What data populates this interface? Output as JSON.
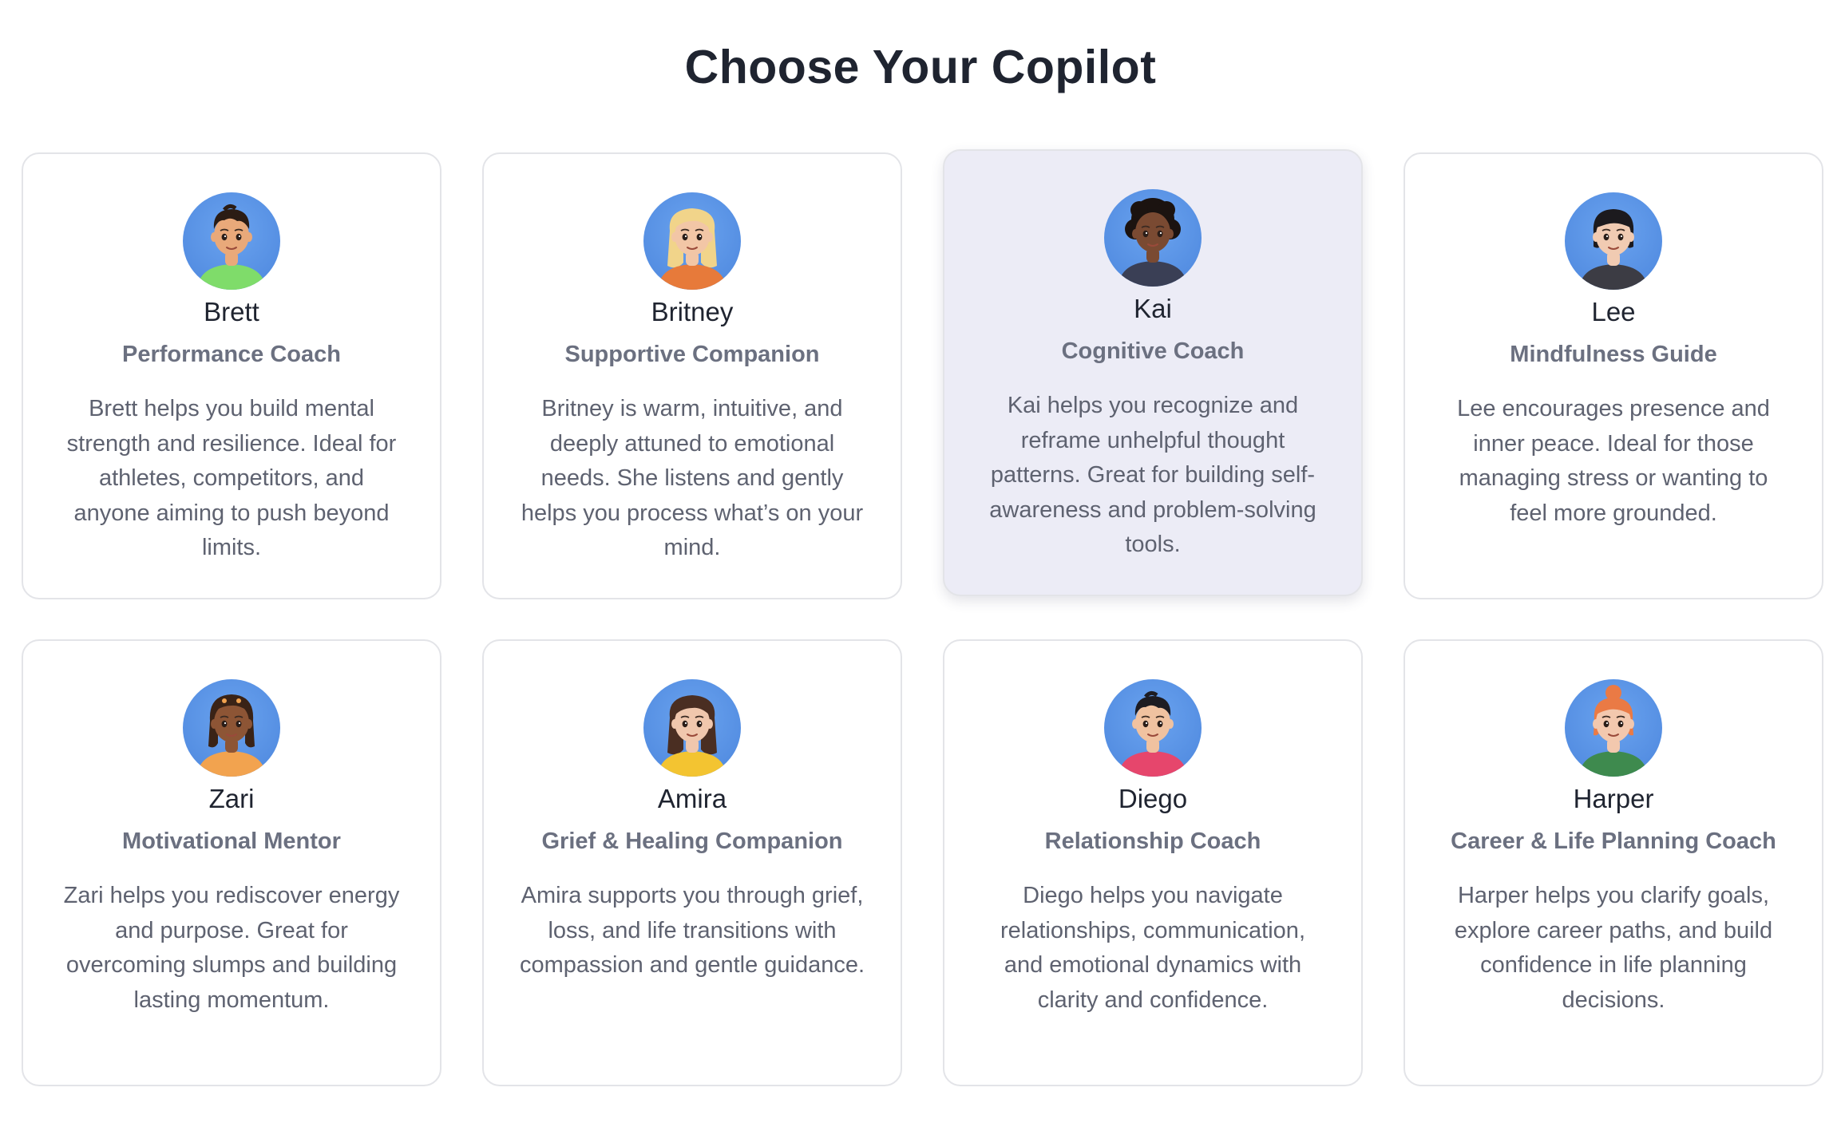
{
  "page": {
    "title": "Choose Your Copilot"
  },
  "selected": "kai",
  "copilots": [
    {
      "id": "brett",
      "name": "Brett",
      "role": "Performance Coach",
      "description": "Brett helps you build mental strength and resilience. Ideal for athletes, competitors, and anyone aiming to push beyond limits.",
      "avatar": {
        "skin": "#e9a97a",
        "hair": "#2b1c14",
        "shirt": "#7fdc6a",
        "hair_style": "short"
      }
    },
    {
      "id": "britney",
      "name": "Britney",
      "role": "Supportive Companion",
      "description": "Britney is warm, intuitive, and deeply attuned to emotional needs. She listens and gently helps you process what’s on your mind.",
      "avatar": {
        "skin": "#f2c6a6",
        "hair": "#f1d48a",
        "shirt": "#e77a3a",
        "hair_style": "long"
      }
    },
    {
      "id": "kai",
      "name": "Kai",
      "role": "Cognitive Coach",
      "description": "Kai helps you recognize and reframe unhelpful thought patterns. Great for building self-awareness and problem-solving tools.",
      "avatar": {
        "skin": "#7a4a32",
        "hair": "#1b1310",
        "shirt": "#3a3f55",
        "hair_style": "curly"
      }
    },
    {
      "id": "lee",
      "name": "Lee",
      "role": "Mindfulness Guide",
      "description": "Lee encourages presence and inner peace. Ideal for those managing stress or wanting to feel more grounded.",
      "avatar": {
        "skin": "#f1cbb2",
        "hair": "#1c1a1e",
        "shirt": "#3c3c44",
        "hair_style": "bob"
      }
    },
    {
      "id": "zari",
      "name": "Zari",
      "role": "Motivational Mentor",
      "description": "Zari helps you rediscover energy and purpose. Great for overcoming slumps and building lasting momentum.",
      "avatar": {
        "skin": "#8d5535",
        "hair": "#3a2316",
        "shirt": "#f2a34f",
        "hair_style": "locs"
      }
    },
    {
      "id": "amira",
      "name": "Amira",
      "role": "Grief & Healing Companion",
      "description": "Amira supports you through grief, loss, and life transitions with compassion and gentle guidance.",
      "avatar": {
        "skin": "#f0c7ad",
        "hair": "#4a2e22",
        "shirt": "#f3c431",
        "hair_style": "long"
      }
    },
    {
      "id": "diego",
      "name": "Diego",
      "role": "Relationship Coach",
      "description": "Diego helps you navigate relationships, communication, and emotional dynamics with clarity and confidence.",
      "avatar": {
        "skin": "#f0c2a0",
        "hair": "#1d1c22",
        "shirt": "#e6466c",
        "hair_style": "short"
      }
    },
    {
      "id": "harper",
      "name": "Harper",
      "role": "Career & Life Planning Coach",
      "description": "Harper helps you clarify goals, explore career paths, and build confidence in life planning decisions.",
      "avatar": {
        "skin": "#f3c8ae",
        "hair": "#ea7a45",
        "shirt": "#3e8a4e",
        "hair_style": "bun"
      }
    }
  ]
}
